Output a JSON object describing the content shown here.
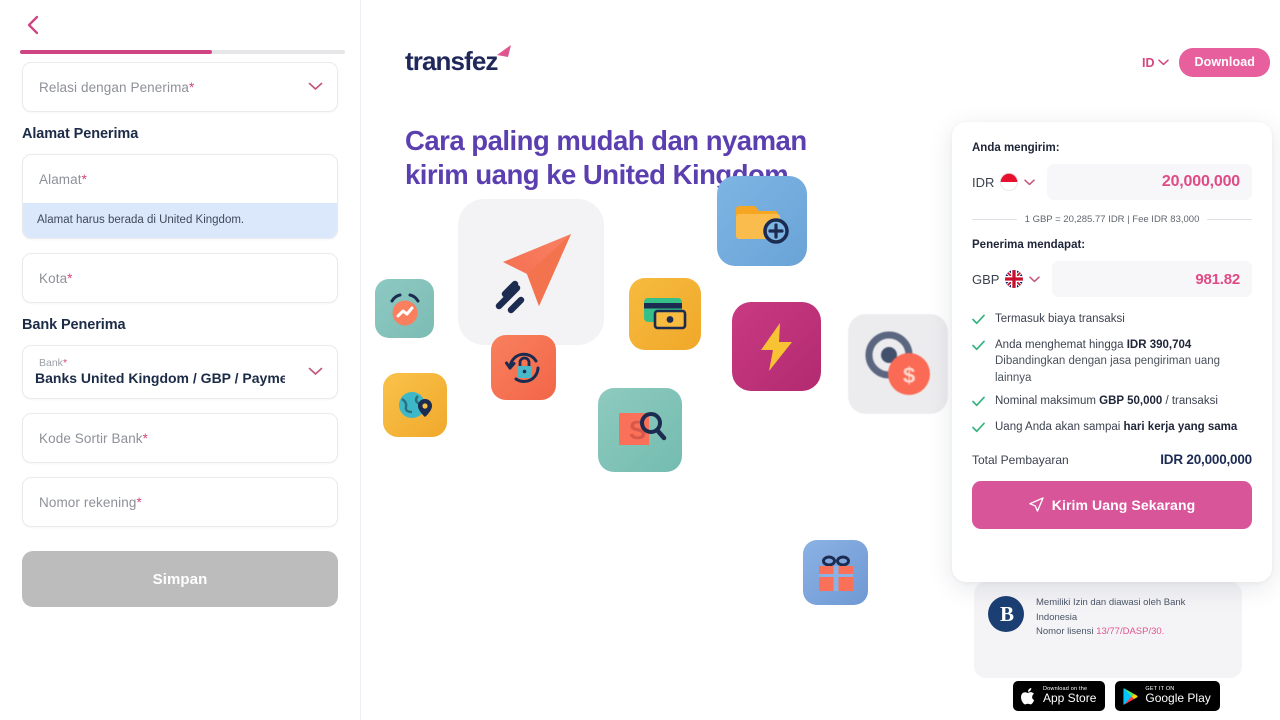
{
  "sidebar": {
    "back_icon": "chevron-left-icon",
    "progress_percent": 59,
    "relation_field": {
      "placeholder": "Relasi dengan Penerima",
      "required_mark": "*"
    },
    "address_section_title": "Alamat Penerima",
    "address_field": {
      "placeholder": "Alamat",
      "required_mark": "*"
    },
    "address_hint": "Alamat harus berada di United Kingdom.",
    "city_field": {
      "placeholder": "Kota",
      "required_mark": "*"
    },
    "bank_section_title": "Bank Penerima",
    "bank_field": {
      "label": "Bank",
      "required_mark": "*",
      "value": "Banks United Kingdom / GBP / Paymen..."
    },
    "sort_code_field": {
      "placeholder": "Kode Sortir Bank",
      "required_mark": "*"
    },
    "account_field": {
      "placeholder": "Nomor rekening",
      "required_mark": "*"
    },
    "save_button": "Simpan"
  },
  "header": {
    "logo_text": "transfez",
    "language": "ID",
    "language_chevron_icon": "chevron-down-icon",
    "download_button": "Download"
  },
  "hero": {
    "line1": "Cara paling mudah dan nyaman",
    "line2": "kirim uang ke United Kingdom"
  },
  "illustration": {
    "icons": [
      {
        "name": "paper-plane-icon",
        "bg": "#f2f2f4"
      },
      {
        "name": "alarm-chart-icon",
        "bg": "#84c3bd"
      },
      {
        "name": "globe-location-icon",
        "bg": "#f6b93b"
      },
      {
        "name": "lock-refresh-icon",
        "bg": "#f4724e"
      },
      {
        "name": "card-cash-icon",
        "bg": "#f2b332"
      },
      {
        "name": "money-search-icon",
        "bg": "#77bfb3"
      },
      {
        "name": "folder-add-icon",
        "bg": "#6ba8dd"
      },
      {
        "name": "lightning-bolt-icon",
        "bg": "#c0317a"
      },
      {
        "name": "coin-target-icon",
        "bg": "#ebebed"
      },
      {
        "name": "gift-box-icon",
        "bg": "#7ea9e0"
      }
    ]
  },
  "calculator": {
    "send_label": "Anda mengirim:",
    "send_currency": "IDR",
    "send_flag_icon": "indonesia-flag-icon",
    "send_amount": "20,000,000",
    "rate_text": "1 GBP = 20,285.77 IDR | Fee IDR 83,000",
    "receive_label": "Penerima mendapat:",
    "receive_currency": "GBP",
    "receive_flag_icon": "uk-flag-icon",
    "receive_amount": "981.82",
    "benefits": [
      {
        "text": "Termasuk biaya transaksi",
        "bold": "",
        "after": "",
        "sub": ""
      },
      {
        "text": "Anda menghemat hingga ",
        "bold": "IDR 390,704",
        "after": "",
        "sub": "Dibandingkan dengan jasa pengiriman uang lainnya"
      },
      {
        "text": "Nominal maksimum ",
        "bold": "GBP 50,000",
        "after": " / transaksi",
        "sub": ""
      },
      {
        "text": "Uang Anda akan sampai ",
        "bold": "hari kerja yang sama",
        "after": "",
        "sub": ""
      }
    ],
    "total_label": "Total Pembayaran",
    "total_value": "IDR 20,000,000",
    "cta_icon": "send-plane-icon",
    "cta_label": "Kirim Uang Sekarang"
  },
  "license": {
    "line1": "Memiliki Izin dan diawasi oleh Bank",
    "line2": "Indonesia",
    "line3_prefix": "Nomor lisensi ",
    "line3_number": "13/77/DASP/30.",
    "logo_icon": "bank-indonesia-logo-icon"
  },
  "stores": {
    "apple": {
      "icon": "apple-icon",
      "top": "Download on the",
      "bottom": "App Store"
    },
    "google": {
      "icon": "google-play-icon",
      "top": "GET IT ON",
      "bottom": "Google Play"
    }
  },
  "colors": {
    "pink": "#d9559a",
    "pink_dark": "#cf4583",
    "purple": "#5b3fb0",
    "navy": "#20285a"
  }
}
